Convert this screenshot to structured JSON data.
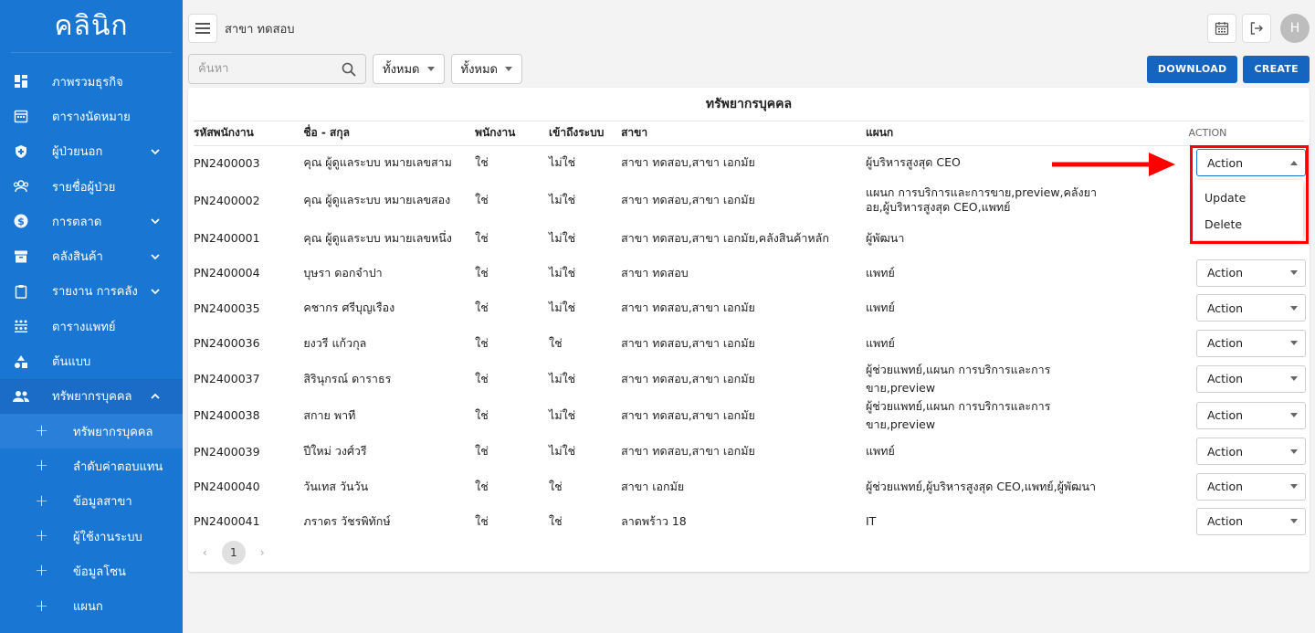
{
  "app": {
    "brand": "คลินิก"
  },
  "sidebar": {
    "items": [
      {
        "label": "ภาพรวมธุรกิจ",
        "icon": "dashboard-icon",
        "chevron": false
      },
      {
        "label": "ตารางนัดหมาย",
        "icon": "calendar-icon",
        "chevron": false
      },
      {
        "label": "ผู้ป่วยนอก",
        "icon": "shield-icon",
        "chevron": true
      },
      {
        "label": "รายชื่อผู้ป่วย",
        "icon": "people-icon",
        "chevron": false
      },
      {
        "label": "การตลาด",
        "icon": "dollar-icon",
        "chevron": true
      },
      {
        "label": "คลังสินค้า",
        "icon": "inventory-icon",
        "chevron": true
      },
      {
        "label": "รายงาน การคลัง",
        "icon": "clipboard-icon",
        "chevron": true
      },
      {
        "label": "ตารางแพทย์",
        "icon": "schedule-icon",
        "chevron": false
      },
      {
        "label": "ต้นแบบ",
        "icon": "shapes-icon",
        "chevron": false
      },
      {
        "label": "ทรัพยากรบุคคล",
        "icon": "group-icon",
        "chevron": true
      }
    ],
    "subitems": [
      {
        "label": "ทรัพยากรบุคคล",
        "active": true
      },
      {
        "label": "ลำดับค่าตอบแทน"
      },
      {
        "label": "ข้อมูลสาขา"
      },
      {
        "label": "ผู้ใช้งานระบบ"
      },
      {
        "label": "ข้อมูลโซน"
      },
      {
        "label": "แผนก"
      }
    ]
  },
  "topbar": {
    "branch": "สาขา ทดสอบ",
    "avatar_letter": "H"
  },
  "filters": {
    "search_placeholder": "ค้นหา",
    "select1": "ทั้งหมด",
    "select2": "ทั้งหมด",
    "download_label": "DOWNLOAD",
    "create_label": "CREATE"
  },
  "table": {
    "title": "ทรัพยากรบุคคล",
    "columns": [
      "รหัสพนักงาน",
      "ชื่อ - สกุล",
      "พนักงาน",
      "เข้าถึงระบบ",
      "สาขา",
      "แผนก",
      "ACTION"
    ],
    "rows": [
      [
        "PN2400003",
        "คุณ ผู้ดูแลระบบ หมายเลขสาม",
        "ใช่",
        "ไม่ใช่",
        "สาขา ทดสอบ,สาขา เอกมัย",
        "ผู้บริหารสูงสุด CEO"
      ],
      [
        "PN2400002",
        "คุณ ผู้ดูแลระบบ หมายเลขสอง",
        "ใช่",
        "ไม่ใช่",
        "สาขา ทดสอบ,สาขา เอกมัย",
        "แผนก การบริการและการขาย,preview,คลังยา อย,ผู้บริหารสูงสุด CEO,แพทย์"
      ],
      [
        "PN2400001",
        "คุณ ผู้ดูแลระบบ หมายเลขหนึ่ง",
        "ใช่",
        "ไม่ใช่",
        "สาขา ทดสอบ,สาขา เอกมัย,คลังสินค้าหลัก",
        "ผู้พัฒนา"
      ],
      [
        "PN2400004",
        "บุษรา ดอกจำปา",
        "ใช่",
        "ไม่ใช่",
        "สาขา ทดสอบ",
        "แพทย์"
      ],
      [
        "PN2400035",
        "คชากร ศรีบุญเรือง",
        "ใช่",
        "ไม่ใช่",
        "สาขา ทดสอบ,สาขา เอกมัย",
        "แพทย์"
      ],
      [
        "PN2400036",
        "ยงวรี แก้วกุล",
        "ใช่",
        "ใช่",
        "สาขา ทดสอบ,สาขา เอกมัย",
        "แพทย์"
      ],
      [
        "PN2400037",
        "สิรินุกรณ์ ดาราธร",
        "ใช่",
        "ไม่ใช่",
        "สาขา ทดสอบ,สาขา เอกมัย",
        "ผู้ช่วยแพทย์,แผนก การบริการและการขาย,preview"
      ],
      [
        "PN2400038",
        "สกาย พาที",
        "ใช่",
        "ไม่ใช่",
        "สาขา ทดสอบ,สาขา เอกมัย",
        "ผู้ช่วยแพทย์,แผนก การบริการและการขาย,preview"
      ],
      [
        "PN2400039",
        "ปีใหม่ วงศ์วรี",
        "ใช่",
        "ไม่ใช่",
        "สาขา ทดสอบ,สาขา เอกมัย",
        "แพทย์"
      ],
      [
        "PN2400040",
        "วันเทส วันวัน",
        "ใช่",
        "ใช่",
        "สาขา เอกมัย",
        "ผู้ช่วยแพทย์,ผู้บริหารสูงสุด CEO,แพทย์,ผู้พัฒนา"
      ],
      [
        "PN2400041",
        "ภราดร วัชรพิทักษ์",
        "ใช่",
        "ใช่",
        "ลาดพร้าว 18",
        "IT"
      ]
    ],
    "action_label": "Action"
  },
  "action_menu": {
    "items": [
      "Update",
      "Delete"
    ]
  },
  "pagination": {
    "current": "1"
  },
  "colors": {
    "sidebar": "#1976d2",
    "primary_button": "#1565c0",
    "highlight": "#ff0000"
  }
}
